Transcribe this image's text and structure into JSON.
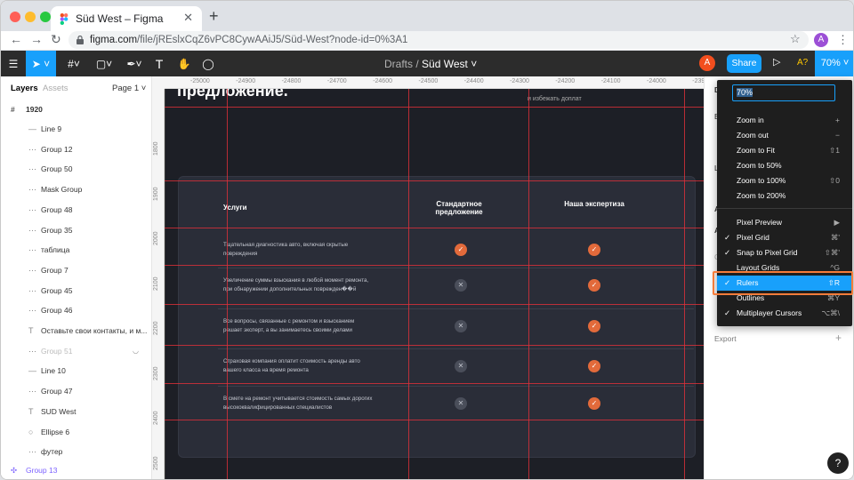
{
  "browser": {
    "tab_title": "Süd West – Figma",
    "url_host": "figma.com",
    "url_path": "/file/jREslxCqZ6vPC8CywAAiJ5/Süd-West?node-id=0%3A1",
    "profile_initial": "A"
  },
  "toolbar": {
    "breadcrumb_drafts": "Drafts",
    "breadcrumb_sep": "/",
    "file_name": "Süd West",
    "user_initial": "A",
    "share_label": "Share",
    "aq_label": "A?",
    "zoom_label": "70%"
  },
  "left_panel": {
    "tab_layers": "Layers",
    "tab_assets": "Assets",
    "page_label": "Page 1",
    "frame_name": "1920",
    "layers": [
      "Line 9",
      "Group 12",
      "Group 50",
      "Mask Group",
      "Group 48",
      "Group 35",
      "таблица",
      "Group 7",
      "Group 45",
      "Group 46",
      "Оставьте свои контакты, и м...",
      "Group 51",
      "Line 10",
      "Group 47",
      "SUD West",
      "Ellipse 6",
      "футер"
    ],
    "selected_layer": "Group 13"
  },
  "canvas": {
    "ruler_x": [
      "-25000",
      "-24900",
      "-24800",
      "-24700",
      "-24600",
      "-24500",
      "-24400",
      "-24300",
      "-24200",
      "-24100",
      "-24000",
      "-23900"
    ],
    "ruler_y": [
      "1800",
      "1900",
      "2000",
      "2100",
      "2200",
      "2300",
      "2400",
      "2500"
    ],
    "heading_partial": "предложение.",
    "note_partial": "и избежать доплат",
    "table": {
      "col_services": "Услуги",
      "col_standard": "Стандартное предложение",
      "col_ours": "Наша экспертиза",
      "rows": [
        {
          "text": "Тщательная диагностика авто, включая скрытые повреждения",
          "standard": "✓",
          "ours": "✓"
        },
        {
          "text": "Увеличение суммы взыскания в любой момент ремонта, при обнаружении дополнительных поврежден��й",
          "standard": "✕",
          "ours": "✓"
        },
        {
          "text": "Все вопросы, связанные с ремонтом и взысканием решает эксперт, а вы занимаетесь своими делами",
          "standard": "✕",
          "ours": "✓"
        },
        {
          "text": "Страховая компания оплатит стоимость аренды авто вашего класса на время ремонта",
          "standard": "✕",
          "ours": "✓"
        },
        {
          "text": "В смете на ремонт учитывается стоимость самых дорогих высококвалифицированных специалистов",
          "standard": "✕",
          "ours": "✓"
        }
      ]
    }
  },
  "right_panel": {
    "d": "D",
    "e": "E",
    "l": "L",
    "a1": "A",
    "a2": "A",
    "c": "C",
    "export_label": "Export",
    "help": "?"
  },
  "zoom_menu": {
    "input_value": "70%",
    "items": [
      {
        "label": "Zoom in",
        "shortcut": "+",
        "checked": false
      },
      {
        "label": "Zoom out",
        "shortcut": "−",
        "checked": false
      },
      {
        "label": "Zoom to Fit",
        "shortcut": "⇧1",
        "checked": false
      },
      {
        "label": "Zoom to 50%",
        "shortcut": "",
        "checked": false
      },
      {
        "label": "Zoom to 100%",
        "shortcut": "⇧0",
        "checked": false
      },
      {
        "label": "Zoom to 200%",
        "shortcut": "",
        "checked": false
      }
    ],
    "items2": [
      {
        "label": "Pixel Preview",
        "shortcut": "▶",
        "checked": false
      },
      {
        "label": "Pixel Grid",
        "shortcut": "⌘'",
        "checked": true
      },
      {
        "label": "Snap to Pixel Grid",
        "shortcut": "⇧⌘'",
        "checked": true
      },
      {
        "label": "Layout Grids",
        "shortcut": "^G",
        "checked": false
      },
      {
        "label": "Rulers",
        "shortcut": "⇧R",
        "checked": true
      },
      {
        "label": "Outlines",
        "shortcut": "⌘Y",
        "checked": false
      },
      {
        "label": "Multiplayer Cursors",
        "shortcut": "⌥⌘\\",
        "checked": true
      }
    ]
  },
  "colors": {
    "accent": "#18a0fb",
    "ok": "#e26a3b",
    "highlight": "#f57c3a"
  }
}
